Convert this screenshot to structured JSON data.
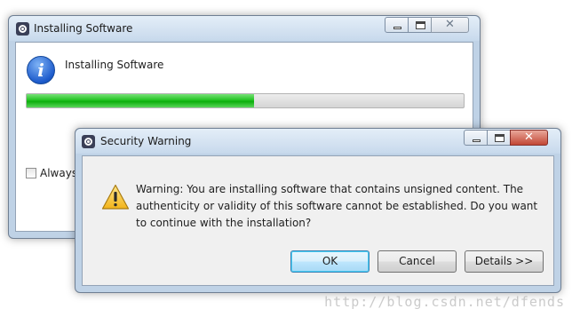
{
  "background_window": {
    "title": "Installing Software",
    "heading": "Installing Software",
    "progress": 0.52,
    "checkbox_label": "Always",
    "checkbox_checked": false
  },
  "dialog": {
    "title": "Security Warning",
    "message": "Warning: You are installing software that contains unsigned content. The authenticity or validity of this software cannot be established. Do you want to continue with the installation?",
    "buttons": {
      "ok": "OK",
      "cancel": "Cancel",
      "details": "Details >>"
    }
  },
  "watermark": "http://blog.csdn.net/dfends",
  "colors": {
    "progress_green": "#22c322",
    "default_button_border": "#3c7fb1",
    "close_button_red": "#c24735"
  },
  "icons": {
    "app": "eclipse-icon",
    "info": "info-icon",
    "warning": "warning-icon"
  }
}
